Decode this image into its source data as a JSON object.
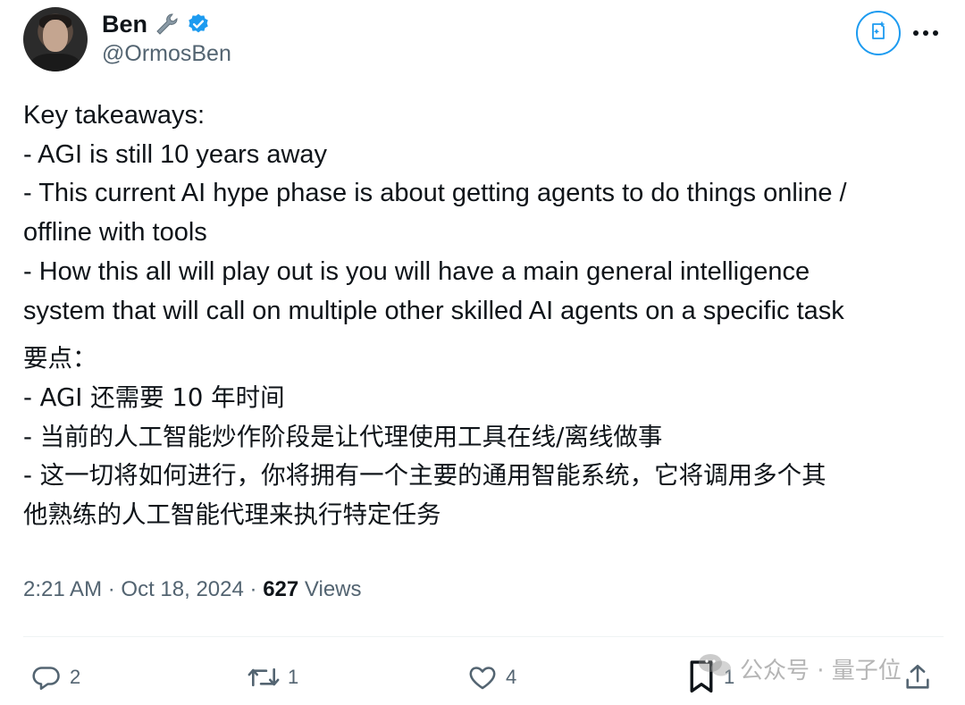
{
  "author": {
    "display_name": "Ben",
    "handle": "@OrmosBen",
    "avatar_icon": "profile-photo",
    "badge_emoji": "wrench-icon",
    "verified_icon": "verified-badge-icon"
  },
  "header_actions": {
    "grok_icon": "grok-icon",
    "more_icon": "more-horizontal-icon"
  },
  "tweet": {
    "en_lines": [
      "Key takeaways:",
      "- AGI is still 10 years away",
      "- This current AI hype phase is about getting agents to do things online /",
      "offline with tools",
      "- How this all will play out is you will have a main general intelligence",
      "system that will call on multiple other skilled AI agents on a specific task"
    ],
    "zh_lines": [
      "要点：",
      "- AGI 还需要 10 年时间",
      "- 当前的人工智能炒作阶段是让代理使用工具在线/离线做事",
      "- 这一切将如何进行，你将拥有一个主要的通用智能系统，它将调用多个其",
      "他熟练的人工智能代理来执行特定任务"
    ]
  },
  "meta": {
    "time": "2:21 AM",
    "separator": "·",
    "date": "Oct 18, 2024",
    "views_count": "627",
    "views_label": "Views"
  },
  "actions": {
    "replies": "2",
    "reposts": "1",
    "likes": "4",
    "bookmarks": "1"
  },
  "watermark": {
    "text": "公众号 · 量子位",
    "icon": "wechat-icon"
  },
  "colors": {
    "accent": "#1d9bf0",
    "text_primary": "#0f1419",
    "text_secondary": "#536471"
  }
}
